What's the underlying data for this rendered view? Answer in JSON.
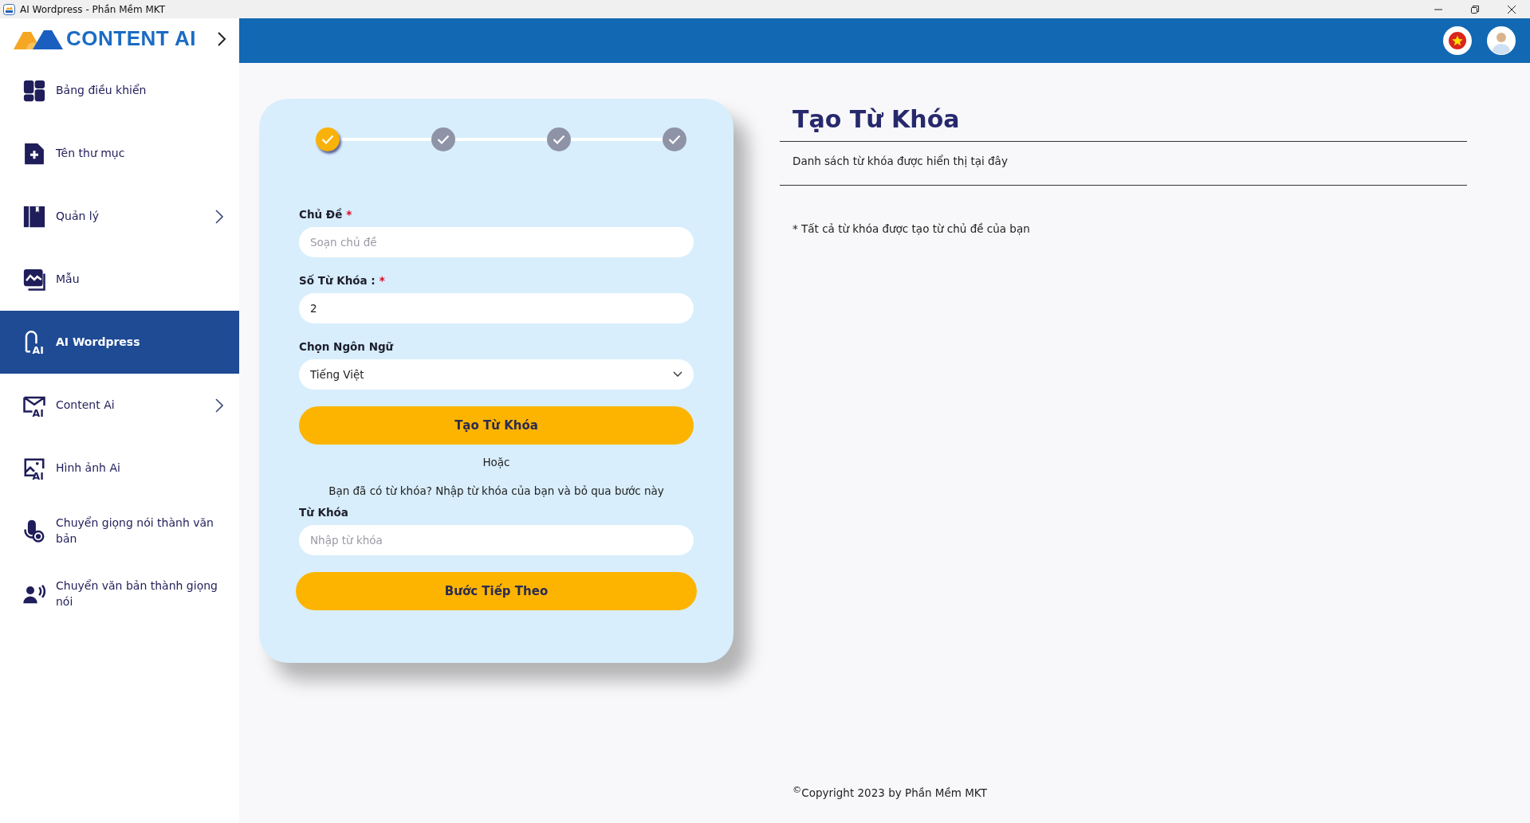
{
  "window": {
    "title": "AI Wordpress - Phần Mềm MKT"
  },
  "sidebar": {
    "logo": "CONTENT AI",
    "items": [
      {
        "label": "Bảng điều khiển",
        "kind": "dashboard",
        "selected": false,
        "has_submenu": false
      },
      {
        "label": "Tên thư mục",
        "kind": "folder",
        "selected": false,
        "has_submenu": false
      },
      {
        "label": "Quản lý",
        "kind": "manage",
        "selected": false,
        "has_submenu": true
      },
      {
        "label": "Mẫu",
        "kind": "template",
        "selected": false,
        "has_submenu": false
      },
      {
        "label": "AI Wordpress",
        "kind": "wordpress",
        "icon_text": "AI",
        "selected": true,
        "has_submenu": false
      },
      {
        "label": "Content Ai",
        "kind": "mail",
        "icon_text": "AI",
        "selected": false,
        "has_submenu": true
      },
      {
        "label": "Hình ảnh Ai",
        "kind": "image",
        "icon_text": "AI",
        "selected": false,
        "has_submenu": false
      },
      {
        "label": "Chuyển giọng nói thành văn bản",
        "kind": "mic",
        "selected": false,
        "has_submenu": false
      },
      {
        "label": "Chuyển văn bản thành giọng nói",
        "kind": "speaker",
        "selected": false,
        "has_submenu": false
      }
    ]
  },
  "form": {
    "steps": [
      {
        "selected": true
      },
      {
        "selected": false
      },
      {
        "selected": false
      },
      {
        "selected": false
      }
    ],
    "topic": {
      "label": "Chủ Đề",
      "required_mark": "*",
      "placeholder": "Soạn chủ đề"
    },
    "count": {
      "label": "Số Từ Khóa :",
      "required_mark": "*",
      "value": "2"
    },
    "language": {
      "label": "Chọn Ngôn Ngữ",
      "value": "Tiếng Việt"
    },
    "generate_button": "Tạo Từ Khóa",
    "or_text": "Hoặc",
    "hint": "Bạn đã có từ khóa? Nhập từ khóa của bạn và bỏ qua bước này",
    "keyword": {
      "label": "Từ Khóa",
      "placeholder": "Nhập từ khóa"
    },
    "next_button": "Bước Tiếp Theo"
  },
  "panel": {
    "title": "Tạo Từ Khóa",
    "list_text": "Danh sách từ khóa được hiển thị tại đây",
    "note": "* Tất cả từ khóa được tạo từ chủ đề của bạn"
  },
  "footer": "$^{©}$Copyright 2023 by Phần Mềm MKT"
}
